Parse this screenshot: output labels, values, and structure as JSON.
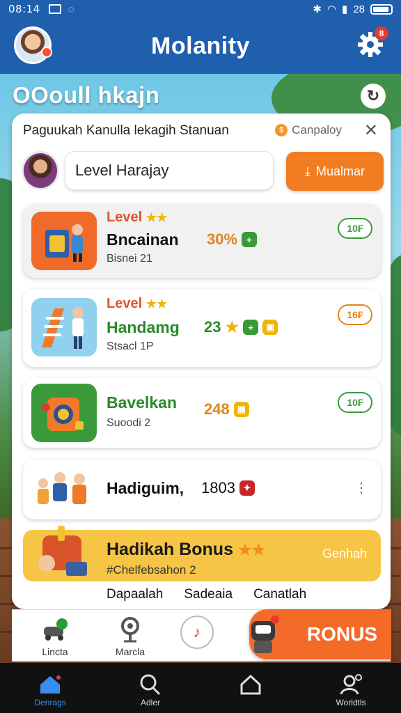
{
  "status_bar": {
    "time": "08:14",
    "right_text": "28"
  },
  "header": {
    "title": "Molanity",
    "settings_badge": "8"
  },
  "page": {
    "heading": "OOoull hkajn"
  },
  "card": {
    "subtitle": "Paguukah Kanulla lekagih Stanuan",
    "company": "Canpaloy",
    "profile": {
      "level_field": "Level Harajay",
      "action_button": "Mualmar"
    }
  },
  "rows": [
    {
      "level": "Level",
      "stars": "★★",
      "name": "Bncainan",
      "value": "30%",
      "sub": "Bisnei 21",
      "pill": "10₣",
      "name_color": "#111111",
      "value_color": "#e0851f",
      "pill_color": "#3a9a3a"
    },
    {
      "level": "Level",
      "stars": "★★",
      "name": "Handamg",
      "value": "23",
      "sub": "Stsacl 1P",
      "pill": "16₣",
      "name_color": "#2a8a2a",
      "value_color": "#2a8a2a",
      "pill_color": "#e0851f"
    },
    {
      "name": "Bavelkan",
      "value": "248",
      "sub": "Suoodi 2",
      "pill": "10₣",
      "name_color": "#2a8a2a",
      "value_color": "#e0851f",
      "pill_color": "#3a9a3a"
    },
    {
      "name": "Hadiguim,",
      "value": "1803",
      "more": "⋮",
      "name_color": "#111111",
      "value_color": "#111111"
    }
  ],
  "bonus": {
    "title": "Hadikah Bonus",
    "stars": "★★",
    "sub": "#Chelfebsahon 2",
    "action": "Genhah"
  },
  "links": [
    "Dapaalah",
    "Sadeaia",
    "Canatlah"
  ],
  "app_tabs": [
    {
      "label": "Lincta"
    },
    {
      "label": "Marcla"
    },
    {
      "label": ""
    }
  ],
  "bonus_button": {
    "label": "RONUS"
  },
  "system_nav": [
    {
      "label": "Denrags"
    },
    {
      "label": "Adler"
    },
    {
      "label": ""
    },
    {
      "label": "Worldtls"
    }
  ],
  "colors": {
    "brand_blue": "#1f5fae",
    "accent_orange": "#f27c22",
    "bonus_yellow": "#f6c545"
  }
}
